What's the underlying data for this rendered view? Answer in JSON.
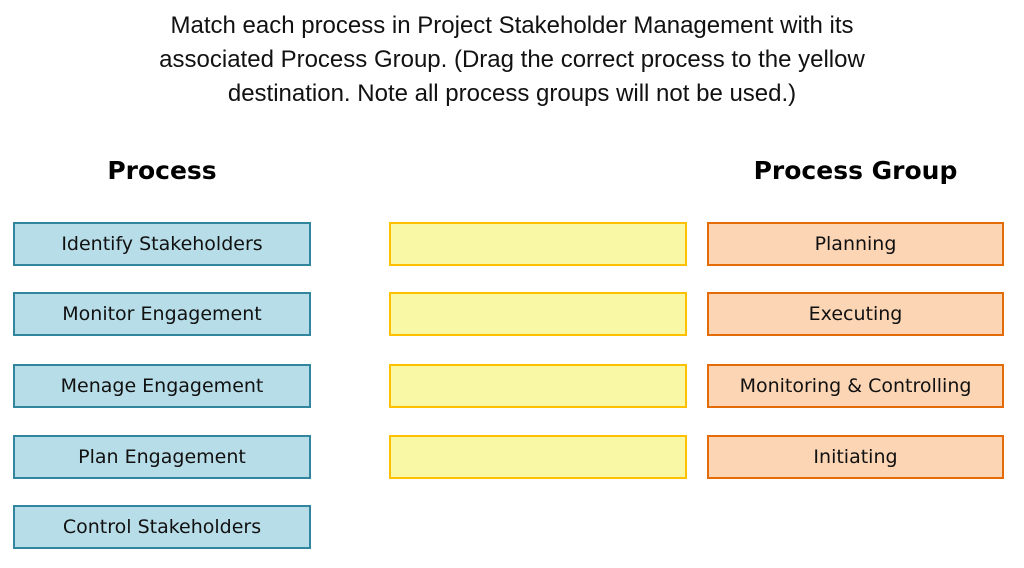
{
  "instructions": [
    "Match each process in Project Stakeholder Management with its",
    "associated Process Group. (Drag the correct process to the yellow",
    "destination. Note all process groups will not be used.)"
  ],
  "headers": {
    "process": "Process",
    "process_group": "Process Group"
  },
  "processes": [
    "Identify Stakeholders",
    "Monitor Engagement",
    "Menage Engagement",
    "Plan Engagement",
    "Control Stakeholders"
  ],
  "drop_targets": [
    "",
    "",
    "",
    ""
  ],
  "process_groups": [
    "Planning",
    "Executing",
    "Monitoring & Controlling",
    "Initiating"
  ],
  "colors": {
    "process_fill": "#b7dde8",
    "process_border": "#31859c",
    "target_fill": "#f8f8a5",
    "target_border": "#ffc000",
    "group_fill": "#fcd5b4",
    "group_border": "#e36c09"
  }
}
